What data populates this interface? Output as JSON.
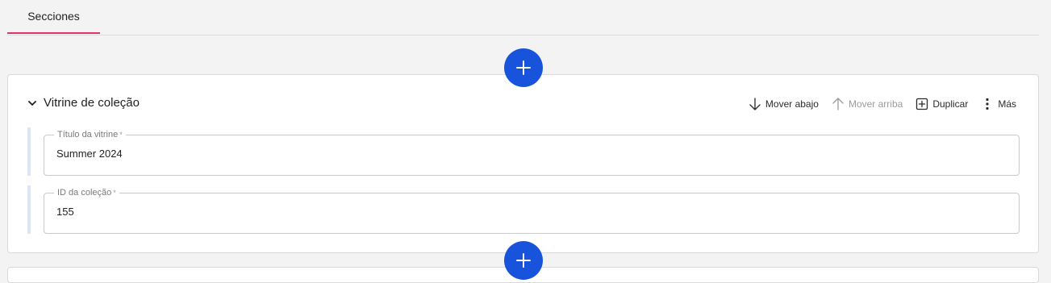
{
  "tabs": [
    {
      "label": "Secciones"
    }
  ],
  "section": {
    "title": "Vitrine de coleção",
    "actions": {
      "move_down": "Mover abajo",
      "move_up": "Mover arriba",
      "duplicate": "Duplicar",
      "more": "Más"
    },
    "fields": [
      {
        "label": "Título da vitrine",
        "required_mark": "*",
        "value": "Summer 2024"
      },
      {
        "label": "ID da coleção",
        "required_mark": "*",
        "value": "155"
      }
    ]
  },
  "colors": {
    "accent_tab": "#e0336b",
    "add_button": "#1853db"
  }
}
